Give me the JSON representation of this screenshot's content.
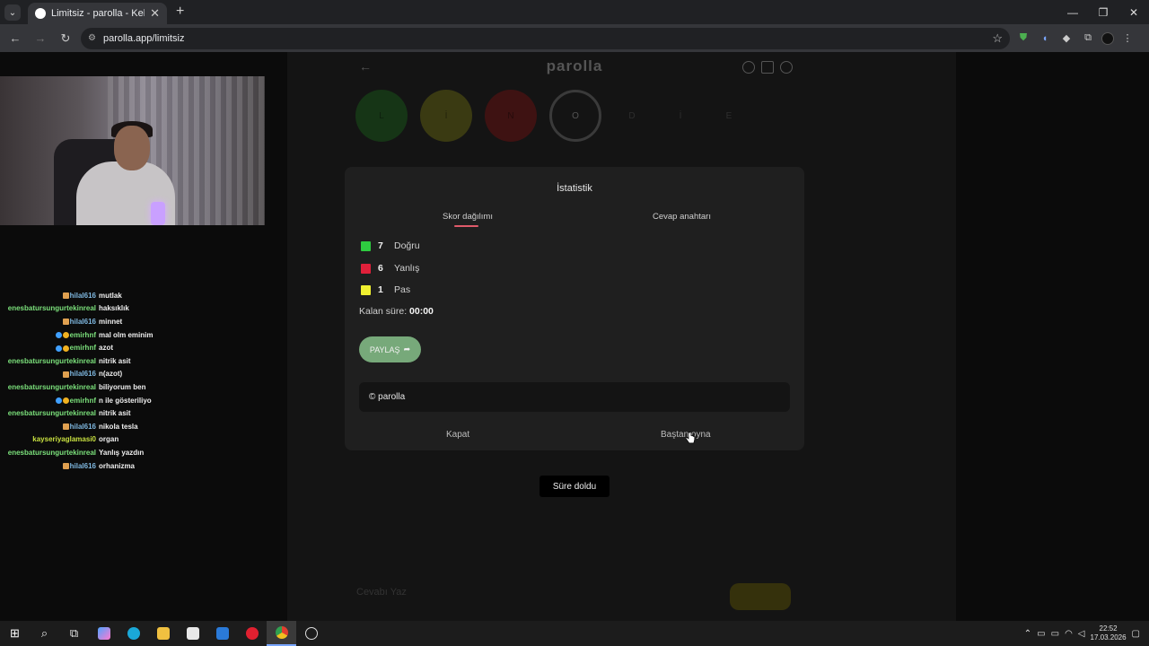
{
  "browser": {
    "tab_title": "Limitsiz - parolla - Kelime oyunu",
    "tab_close": "✕",
    "new_tab": "+",
    "url": "parolla.app/limitsiz",
    "window_controls": [
      "—",
      "❐",
      "✕"
    ]
  },
  "stream": {
    "chat": [
      {
        "user": "hilal616",
        "msg": "mutlak",
        "color": "#7fb8e0",
        "badges": [
          "box"
        ]
      },
      {
        "user": "enesbatursungurtekinreal",
        "msg": "haksıklık",
        "color": "#7be07b",
        "badges": []
      },
      {
        "user": "hilal616",
        "msg": "minnet",
        "color": "#7fb8e0",
        "badges": [
          "box"
        ]
      },
      {
        "user": "emirhnf",
        "msg": "mal olm eminim",
        "color": "#7be07b",
        "badges": [
          "dot",
          "coin"
        ]
      },
      {
        "user": "emirhnf",
        "msg": "azot",
        "color": "#7be07b",
        "badges": [
          "dot",
          "coin"
        ]
      },
      {
        "user": "enesbatursungurtekinreal",
        "msg": "nitrik asit",
        "color": "#7be07b",
        "badges": []
      },
      {
        "user": "hilal616",
        "msg": "n(azot)",
        "color": "#7fb8e0",
        "badges": [
          "box"
        ]
      },
      {
        "user": "enesbatursungurtekinreal",
        "msg": "biliyorum ben",
        "color": "#7be07b",
        "badges": []
      },
      {
        "user": "emirhnf",
        "msg": "n ile gösteriliyo",
        "color": "#7be07b",
        "badges": [
          "dot",
          "coin"
        ]
      },
      {
        "user": "enesbatursungurtekinreal",
        "msg": "nitrik asit",
        "color": "#7be07b",
        "badges": []
      },
      {
        "user": "hilal616",
        "msg": "nikola tesla",
        "color": "#7fb8e0",
        "badges": [
          "box"
        ]
      },
      {
        "user": "kayseriyaglamasi0",
        "msg": "organ",
        "color": "#c8e040",
        "badges": []
      },
      {
        "user": "enesbatursungurtekinreal",
        "msg": "Yanlış yazdın",
        "color": "#7be07b",
        "badges": []
      },
      {
        "user": "hilal616",
        "msg": "orhanizma",
        "color": "#7fb8e0",
        "badges": [
          "box"
        ]
      }
    ]
  },
  "game": {
    "title": "parolla",
    "letters": [
      {
        "char": "L",
        "state": "green"
      },
      {
        "char": "İ",
        "state": "yellow"
      },
      {
        "char": "N",
        "state": "red"
      },
      {
        "char": "O",
        "state": "current"
      },
      {
        "char": "D",
        "state": "empty"
      },
      {
        "char": "İ",
        "state": "empty"
      },
      {
        "char": "E",
        "state": "empty"
      }
    ],
    "toast": "Süre doldu",
    "input_placeholder": "Cevabı Yaz"
  },
  "modal": {
    "title": "İstatistik",
    "tab_score": "Skor dağılımı",
    "tab_answers": "Cevap anahtarı",
    "stats": [
      {
        "count": "7",
        "label": "Doğru",
        "color": "#2ecc40"
      },
      {
        "count": "6",
        "label": "Yanlış",
        "color": "#e0203a"
      },
      {
        "count": "1",
        "label": "Pas",
        "color": "#f0f030"
      }
    ],
    "time_label": "Kalan süre:",
    "time_value": "00:00",
    "share_label": "PAYLAŞ",
    "credit": "© parolla",
    "close_label": "Kapat",
    "restart_label": "Baştan oyna"
  },
  "taskbar": {
    "time": "22:52",
    "date": "17.03.2026"
  }
}
